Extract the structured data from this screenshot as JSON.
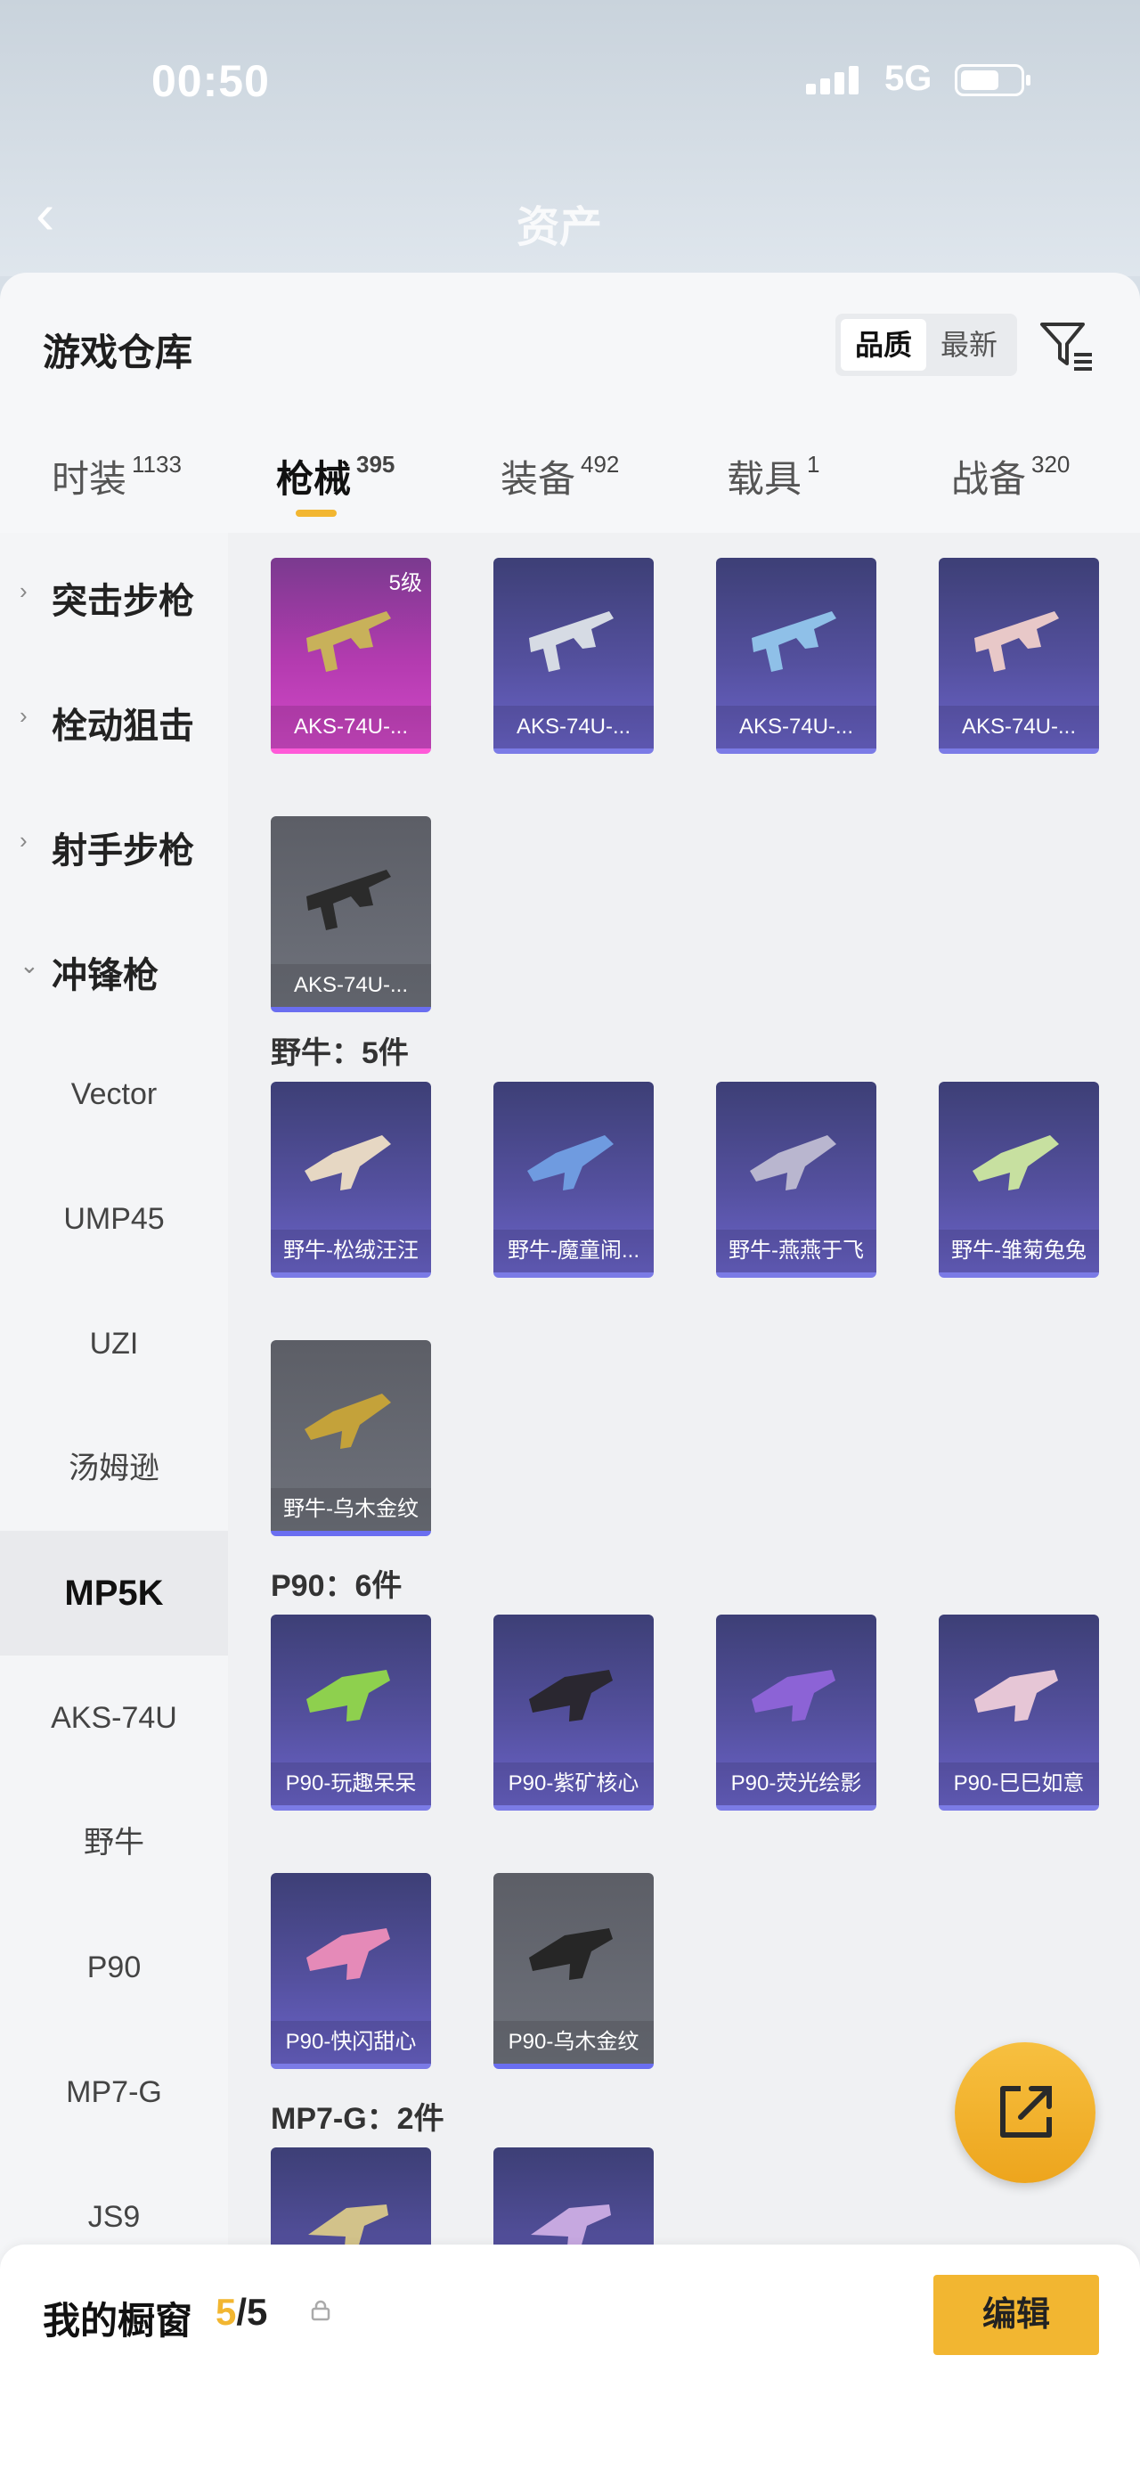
{
  "status": {
    "time": "00:50",
    "network": "5G"
  },
  "bg_title": "资产",
  "sheet": {
    "title": "游戏仓库"
  },
  "sort": {
    "options": [
      "品质",
      "最新"
    ],
    "selected": "品质"
  },
  "tabs": [
    {
      "label": "时装",
      "count": "1133"
    },
    {
      "label": "枪械",
      "count": "395",
      "active": true
    },
    {
      "label": "装备",
      "count": "492"
    },
    {
      "label": "载具",
      "count": "1"
    },
    {
      "label": "战备",
      "count": "320"
    }
  ],
  "sidebar": {
    "categories": [
      {
        "label": "突击步枪",
        "chevron": "›"
      },
      {
        "label": "栓动狙击",
        "chevron": "›"
      },
      {
        "label": "射手步枪",
        "chevron": "›"
      },
      {
        "label": "冲锋枪",
        "chevron": "⌄"
      }
    ],
    "subs": [
      "Vector",
      "UMP45",
      "UZI",
      "汤姆逊",
      "MP5K",
      "AKS-74U",
      "野牛",
      "P90",
      "MP7-G",
      "JS9"
    ],
    "active_sub": "MP5K"
  },
  "groups": {
    "aks": {
      "items": [
        {
          "name": "AKS-74U-...",
          "level": "5级"
        },
        {
          "name": "AKS-74U-..."
        },
        {
          "name": "AKS-74U-..."
        },
        {
          "name": "AKS-74U-..."
        },
        {
          "name": "AKS-74U-..."
        }
      ]
    },
    "bison": {
      "label": "野牛：5件",
      "items": [
        {
          "name": "野牛-松绒汪汪"
        },
        {
          "name": "野牛-魔童闹..."
        },
        {
          "name": "野牛-燕燕于飞"
        },
        {
          "name": "野牛-雏菊兔兔"
        },
        {
          "name": "野牛-乌木金纹"
        }
      ]
    },
    "p90": {
      "label": "P90：6件",
      "items": [
        {
          "name": "P90-玩趣呆呆"
        },
        {
          "name": "P90-紫矿核心"
        },
        {
          "name": "P90-荧光绘影"
        },
        {
          "name": "P90-巳巳如意"
        },
        {
          "name": "P90-快闪甜心"
        },
        {
          "name": "P90-乌木金纹"
        }
      ]
    },
    "mp7": {
      "label": "MP7-G：2件"
    }
  },
  "showcase": {
    "label": "我的橱窗",
    "current": "5",
    "total": "/5",
    "edit_label": "编辑"
  },
  "colors": {
    "accent": "#f2b631"
  }
}
